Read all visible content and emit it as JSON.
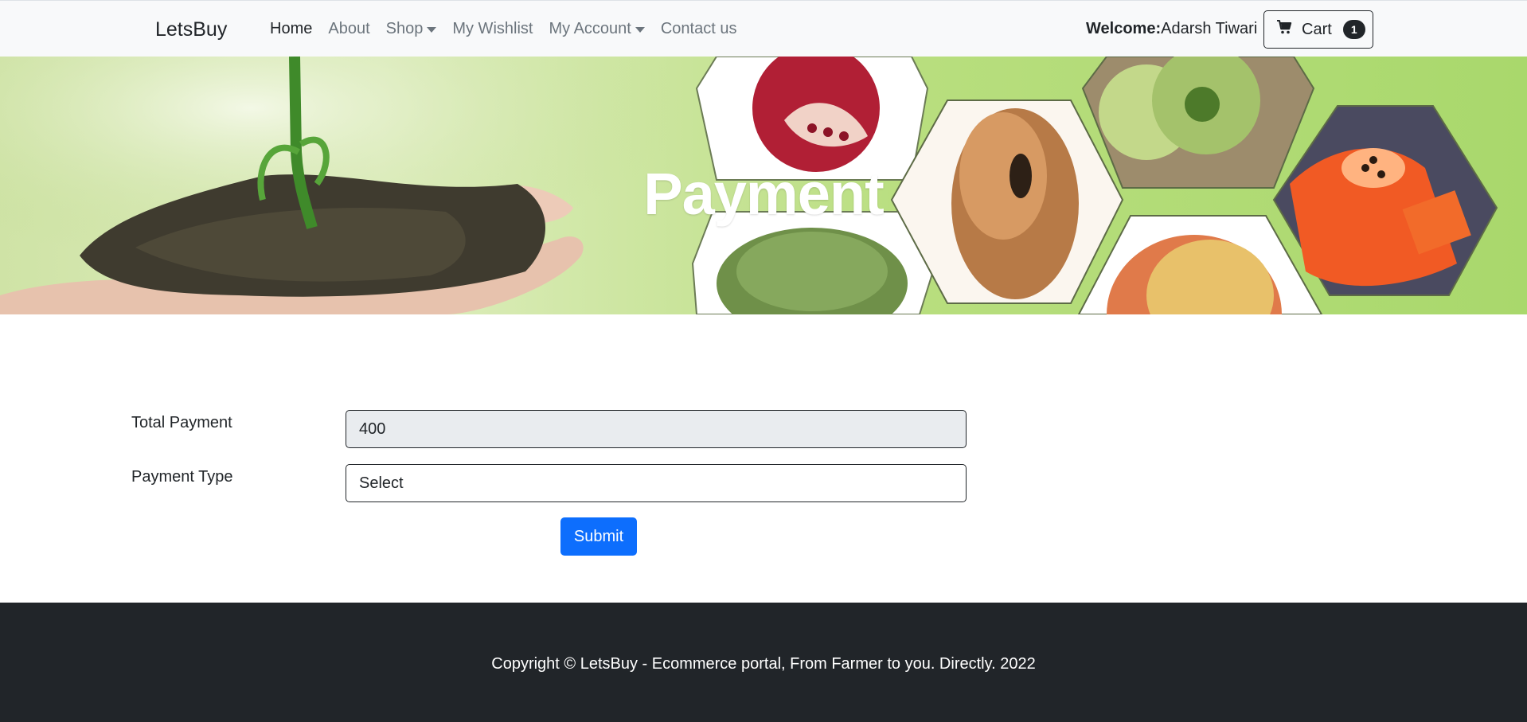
{
  "navbar": {
    "brand": "LetsBuy",
    "items": [
      {
        "label": "Home"
      },
      {
        "label": "About"
      },
      {
        "label": "Shop"
      },
      {
        "label": "My Wishlist"
      },
      {
        "label": "My Account"
      },
      {
        "label": "Contact us"
      }
    ],
    "welcome_label": "Welcome:",
    "user_name": "Adarsh Tiwari",
    "cart_label": "Cart",
    "cart_count": "1"
  },
  "banner": {
    "title": "Payment"
  },
  "form": {
    "total_label": "Total Payment",
    "total_value": "400",
    "type_label": "Payment Type",
    "type_selected": "Select",
    "submit_label": "Submit"
  },
  "footer": {
    "copyright": "Copyright © LetsBuy - Ecommerce portal, From Farmer to you. Directly. 2022"
  },
  "colors": {
    "primary": "#0d6efd",
    "dark": "#212529",
    "navbar_bg": "#f8f9fa",
    "readonly_bg": "#e9ecef"
  },
  "icons": [
    "cart-icon",
    "caret-down-icon"
  ]
}
